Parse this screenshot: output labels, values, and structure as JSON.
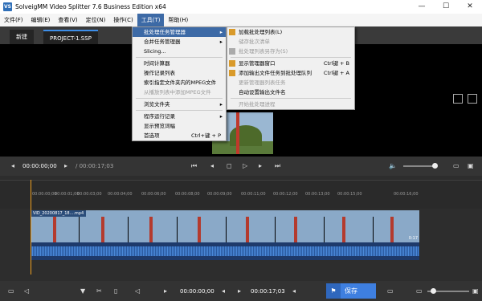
{
  "app": {
    "title": "SolveigMM Video Splitter 7.6 Business Edition x64",
    "icon_text": "VS"
  },
  "window_buttons": {
    "minimize": "—",
    "maximize": "☐",
    "close": "✕"
  },
  "menubar": [
    "文件(F)",
    "编辑(E)",
    "查看(V)",
    "定位(N)",
    "操作(C)",
    "工具(T)",
    "帮助(H)"
  ],
  "tabs": {
    "tab1": "新建",
    "tab2": "PROJECT-1.SSP"
  },
  "tools_menu": {
    "items": [
      {
        "label": "批处理任务管理器",
        "state": "highlight",
        "arrow": "▸"
      },
      {
        "label": "合并任务管理器",
        "state": "normal",
        "arrow": "▸"
      },
      {
        "label": "Slicing...",
        "state": "normal",
        "arrow": ""
      },
      {
        "label": "时间计算器",
        "state": "normal",
        "arrow": ""
      },
      {
        "label": "操作记录列表",
        "state": "normal",
        "arrow": ""
      },
      {
        "label": "索引指定文件夹内的MPEG文件",
        "state": "normal",
        "arrow": ""
      },
      {
        "label": "从播放列表中添加MPEG文件",
        "state": "disabled",
        "arrow": ""
      },
      {
        "label": "浏览文件夹",
        "state": "normal",
        "arrow": "▸"
      },
      {
        "label": "程序运行记录",
        "state": "normal",
        "arrow": "▸"
      },
      {
        "label": "显示预览词幅",
        "state": "normal",
        "arrow": ""
      },
      {
        "label": "首选项",
        "state": "normal",
        "arrow": "",
        "shortcut": "Ctrl+键 + P"
      }
    ]
  },
  "batch_submenu": {
    "items": [
      {
        "label": "加载批处理列表(L)",
        "state": "normal",
        "shortcut": ""
      },
      {
        "label": "储存批次清单",
        "state": "disabled",
        "shortcut": ""
      },
      {
        "label": "批处理列表另存为(S)",
        "state": "disabled",
        "shortcut": ""
      },
      {
        "label": "显示管理器窗口",
        "state": "normal",
        "shortcut": "Ctrl键 + B"
      },
      {
        "label": "添加输出文件任务到批处理队列",
        "state": "normal",
        "shortcut": "Ctrl键 + A"
      },
      {
        "label": "更新管理器列表任务",
        "state": "disabled",
        "shortcut": ""
      },
      {
        "label": "自动设置输出文件名",
        "state": "normal",
        "shortcut": ""
      },
      {
        "label": "开始批处理进程",
        "state": "disabled",
        "shortcut": ""
      }
    ]
  },
  "player": {
    "current_time": "00:00:00;00",
    "total_time": "/ 00:00:17;03"
  },
  "ruler_ticks": [
    "00:00:00;00",
    "00:00:01;00",
    "00:00:03;00",
    "00:00:04;00",
    "00:00:06;00",
    "00:00:08;00",
    "00:00:09;00",
    "00:00:11;00",
    "00:00:12;00",
    "00:00:13;00",
    "00:00:15;00",
    "00:00:16;00"
  ],
  "track": {
    "label": "VID_20200817_18....mp4",
    "end_time": "0:17"
  },
  "bottom": {
    "time_in": "00:00:00;00",
    "time_out": "00:00:17;03",
    "save_label": "保存"
  }
}
